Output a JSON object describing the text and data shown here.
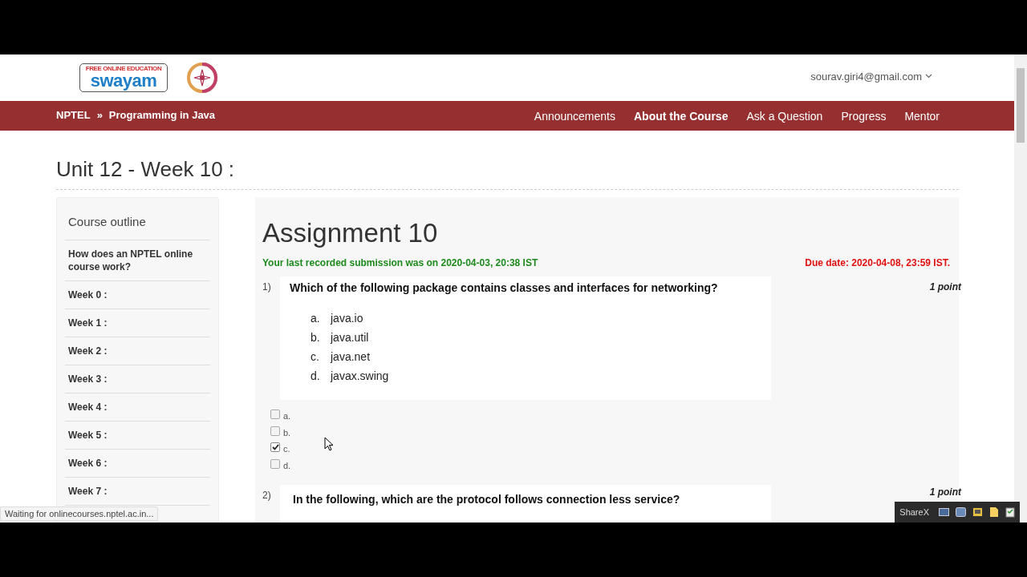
{
  "logo": {
    "tagline": "FREE ONLINE EDUCATION",
    "name": "swayam"
  },
  "user_menu": {
    "email": "sourav.giri4@gmail.com"
  },
  "breadcrumb": [
    "NPTEL",
    "»",
    "Programming in Java"
  ],
  "nav": [
    {
      "label": "Announcements",
      "selected": false
    },
    {
      "label": "About the Course",
      "selected": true
    },
    {
      "label": "Ask a Question",
      "selected": false
    },
    {
      "label": "Progress",
      "selected": false
    },
    {
      "label": "Mentor",
      "selected": false
    }
  ],
  "unit_title": "Unit 12 - Week 10 :",
  "sidebar": {
    "title": "Course outline",
    "items": [
      "How does an NPTEL online course work?",
      "Week 0 :",
      "Week 1 :",
      "Week 2 :",
      "Week 3 :",
      "Week 4 :",
      "Week 5 :",
      "Week 6 :",
      "Week 7 :"
    ]
  },
  "assignment": {
    "title": "Assignment 10",
    "submission": "Your last recorded submission was on 2020-04-03, 20:38 IST",
    "due": "Due date: 2020-04-08, 23:59 IST.",
    "questions": [
      {
        "number": "1)",
        "text": "Which of the following package contains classes and interfaces for networking?",
        "points": "1 point",
        "options": [
          {
            "letter": "a.",
            "text": "java.io"
          },
          {
            "letter": "b.",
            "text": "java.util"
          },
          {
            "letter": "c.",
            "text": "java.net"
          },
          {
            "letter": "d.",
            "text": "javax.swing"
          }
        ],
        "answers": [
          {
            "label": "a.",
            "checked": false
          },
          {
            "label": "b.",
            "checked": false
          },
          {
            "label": "c.",
            "checked": true
          },
          {
            "label": "d.",
            "checked": false
          }
        ]
      },
      {
        "number": "2)",
        "text": "In the following, which are the protocol follows connection less service?",
        "points": "1 point"
      }
    ]
  },
  "status_bar": "Waiting for onlinecourses.nptel.ac.in...",
  "sharex": {
    "label": "ShareX"
  }
}
